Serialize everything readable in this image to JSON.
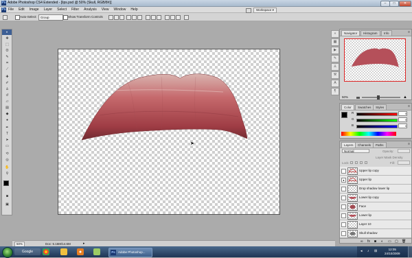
{
  "window": {
    "title": "Adobe Photoshop CS4 Extended - [lips.psd @ 50% (Skull, RGB/8#)]",
    "controls": {
      "minimize": "–",
      "maximize": "□",
      "close": "✕"
    }
  },
  "app_icon": "Ps",
  "menu": {
    "items": [
      "File",
      "Edit",
      "Image",
      "Layer",
      "Select",
      "Filter",
      "Analysis",
      "View",
      "Window",
      "Help"
    ],
    "workspace_label": "Workspace ▾"
  },
  "options_bar": {
    "auto_select_label": "Auto-Select:",
    "auto_select_value": "Group",
    "show_transform_label": "Show Transform Controls"
  },
  "toolbox": {
    "header": "»",
    "tools": [
      "move-tool",
      "marquee-tool",
      "lasso-tool",
      "quick-select-tool",
      "crop-tool",
      "eyedropper-tool",
      "healing-tool",
      "brush-tool",
      "clone-stamp-tool",
      "history-brush-tool",
      "eraser-tool",
      "gradient-tool",
      "blur-tool",
      "dodge-tool",
      "pen-tool",
      "type-tool",
      "path-select-tool",
      "shape-tool",
      "3d-rotate-tool",
      "3d-orbit-tool",
      "hand-tool",
      "zoom-tool"
    ]
  },
  "status": {
    "zoom": "50%",
    "doc_info": "Doc: 5.16M/14.6M"
  },
  "navigator": {
    "tabs": [
      "Navigator",
      "Histogram",
      "Info"
    ],
    "zoom": "50%"
  },
  "color_panel": {
    "tabs": [
      "Color",
      "Swatches",
      "Styles"
    ],
    "channels": [
      {
        "label": "R",
        "value": "0",
        "gradient_end": "#ff0000"
      },
      {
        "label": "G",
        "value": "0",
        "gradient_end": "#00ff00"
      },
      {
        "label": "B",
        "value": "0",
        "gradient_end": "#0000ff"
      }
    ]
  },
  "layers_panel": {
    "tabs": [
      "Layers",
      "Channels",
      "Paths"
    ],
    "blend_mode": "Normal",
    "opacity_label": "Opacity:",
    "lock_label": "Lock:",
    "fill_label": "Fill:",
    "mask_density_label": "Layer Mask Density",
    "layers": [
      "Upper lip copy",
      "Upper lip",
      "Drop shadow lower lip",
      "Lower lip copy",
      "Face",
      "Lower lip",
      "Layer 10",
      "Skull shadow"
    ]
  },
  "taskbar": {
    "search_label": "Google",
    "photoshop_task": "Adobe Photoshop...",
    "clock_time": "12:05",
    "clock_date": "24/10/2009"
  },
  "colors": {
    "lip_red": "#c45a5f",
    "lip_dark": "#7a2f35",
    "panel_bg": "#d6d6d6",
    "workspace_bg": "#ababab"
  }
}
